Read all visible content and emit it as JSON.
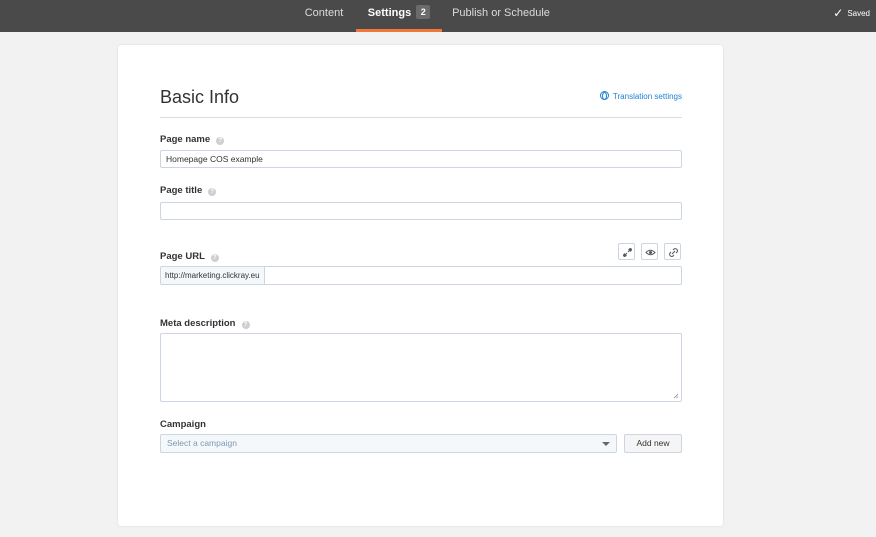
{
  "nav": {
    "tabs": [
      {
        "label": "Content"
      },
      {
        "label": "Settings",
        "badge": "2"
      },
      {
        "label": "Publish or Schedule"
      }
    ],
    "active_tab": "Settings",
    "saved_label": "Saved",
    "accent_color": "#f2773a"
  },
  "section": {
    "title": "Basic Info",
    "translation_link": "Translation settings"
  },
  "fields": {
    "page_name": {
      "label": "Page name",
      "value": "Homepage COS example"
    },
    "page_title": {
      "label": "Page title",
      "value": ""
    },
    "page_url": {
      "label": "Page URL",
      "prefix": "http://marketing.clickray.eu",
      "value": ""
    },
    "meta_description": {
      "label": "Meta description",
      "value": ""
    },
    "campaign": {
      "label": "Campaign",
      "placeholder": "Select a campaign",
      "add_label": "Add new"
    }
  },
  "icons": {
    "url_actions": [
      "edit-link-icon",
      "preview-eye-icon",
      "copy-link-icon"
    ],
    "help": "question-icon",
    "translation": "globe-icon",
    "saved": "checkmark-icon"
  }
}
